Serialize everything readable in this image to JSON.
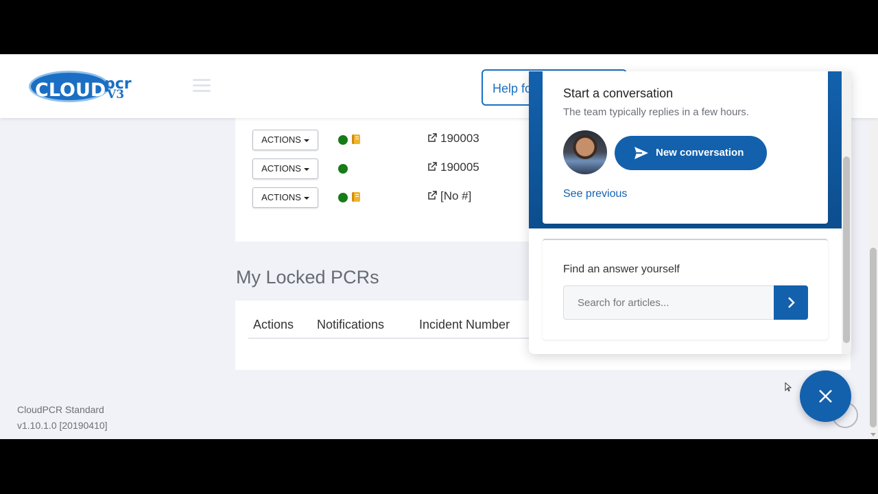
{
  "header": {
    "logo": {
      "cloud": "CLOUD",
      "pcr": "pcr",
      "version": "V3"
    },
    "help_button_label": "Help fo"
  },
  "open_pcrs": {
    "rows": [
      {
        "action_label": "ACTIONS",
        "notification": true,
        "has_note": true,
        "incident_number": "190003"
      },
      {
        "action_label": "ACTIONS",
        "notification": true,
        "has_note": false,
        "incident_number": "190005"
      },
      {
        "action_label": "ACTIONS",
        "notification": true,
        "has_note": true,
        "incident_number": "[No #]"
      }
    ]
  },
  "locked_pcrs": {
    "title": "My Locked PCRs",
    "columns": [
      "Actions",
      "Notifications",
      "Incident Number"
    ]
  },
  "footer": {
    "product": "CloudPCR Standard",
    "version": "v1.10.1.0 [20190410]"
  },
  "chat": {
    "start_title": "Start a conversation",
    "start_subtitle": "The team typically replies in a few hours.",
    "new_conversation_label": "New conversation",
    "see_previous_label": "See previous",
    "find_title": "Find an answer yourself",
    "search_placeholder": "Search for articles...",
    "accent_color": "#1361ad"
  },
  "colors": {
    "status_green": "#177b17",
    "note_yellow": "#f2b32a",
    "brand_blue": "#1a6fc4"
  }
}
